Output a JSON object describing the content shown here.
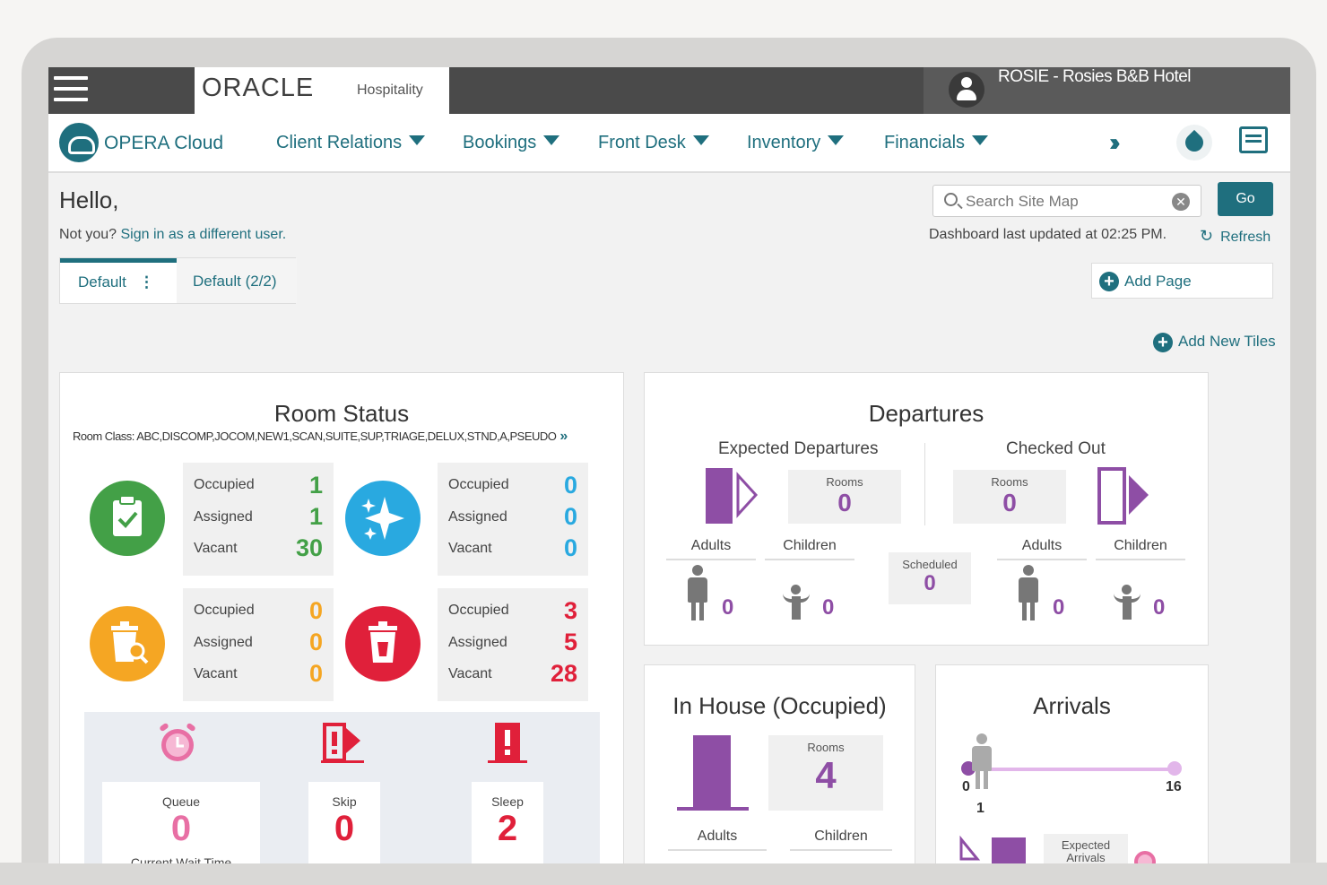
{
  "topbar": {
    "brand_oracle": "ORACLE",
    "brand_product": "Hospitality",
    "user": "ROSIE - Rosies B&B Hotel"
  },
  "nav": {
    "app_name": "OPERA Cloud",
    "items": [
      "Client Relations",
      "Bookings",
      "Front Desk",
      "Inventory",
      "Financials"
    ]
  },
  "greeting": {
    "hello": "Hello,",
    "not_you": "Not you?",
    "sign_in": "Sign in as a different user."
  },
  "search": {
    "placeholder": "Search Site Map",
    "go": "Go"
  },
  "dashboard": {
    "updated": "Dashboard last updated at 02:25 PM.",
    "refresh": "Refresh",
    "tabs": [
      "Default",
      "Default (2/2)"
    ],
    "add_page": "Add Page",
    "add_tiles": "Add New Tiles"
  },
  "room_status": {
    "title": "Room Status",
    "room_class": "Room Class: ABC,DISCOMP,JOCOM,NEW1,SCAN,SUITE,SUP,TRIAGE,DELUX,STND,A,PSEUDO",
    "row_labels": [
      "Occupied",
      "Assigned",
      "Vacant"
    ],
    "groups": [
      {
        "icon": "clipboard-check-icon",
        "color": "#43a047",
        "values": [
          "1",
          "1",
          "30"
        ]
      },
      {
        "icon": "sparkle-icon",
        "color": "#29a9e0",
        "values": [
          "0",
          "0",
          "0"
        ]
      },
      {
        "icon": "inspect-bin-icon",
        "color": "#f5a623",
        "values": [
          "0",
          "0",
          "0"
        ]
      },
      {
        "icon": "trash-icon",
        "color": "#e0203a",
        "values": [
          "3",
          "5",
          "28"
        ]
      }
    ],
    "queue": {
      "label": "Queue",
      "value": "0",
      "sub": "Current Wait Time"
    },
    "skip": {
      "label": "Skip",
      "value": "0"
    },
    "sleep": {
      "label": "Sleep",
      "value": "2"
    }
  },
  "departures": {
    "title": "Departures",
    "expected": "Expected Departures",
    "checked_out": "Checked Out",
    "rooms_label": "Rooms",
    "expected_rooms": "0",
    "checked_rooms": "0",
    "scheduled_label": "Scheduled",
    "scheduled": "0",
    "adults": "Adults",
    "children": "Children",
    "exp_adults": "0",
    "exp_children": "0",
    "co_adults": "0",
    "co_children": "0"
  },
  "in_house": {
    "title": "In House (Occupied)",
    "rooms_label": "Rooms",
    "rooms": "4",
    "adults": "Adults",
    "children": "Children"
  },
  "arrivals": {
    "title": "Arrivals",
    "slider_min": "0",
    "slider_max": "16",
    "slider_value": "1",
    "expected_label": "Expected Arrivals"
  }
}
